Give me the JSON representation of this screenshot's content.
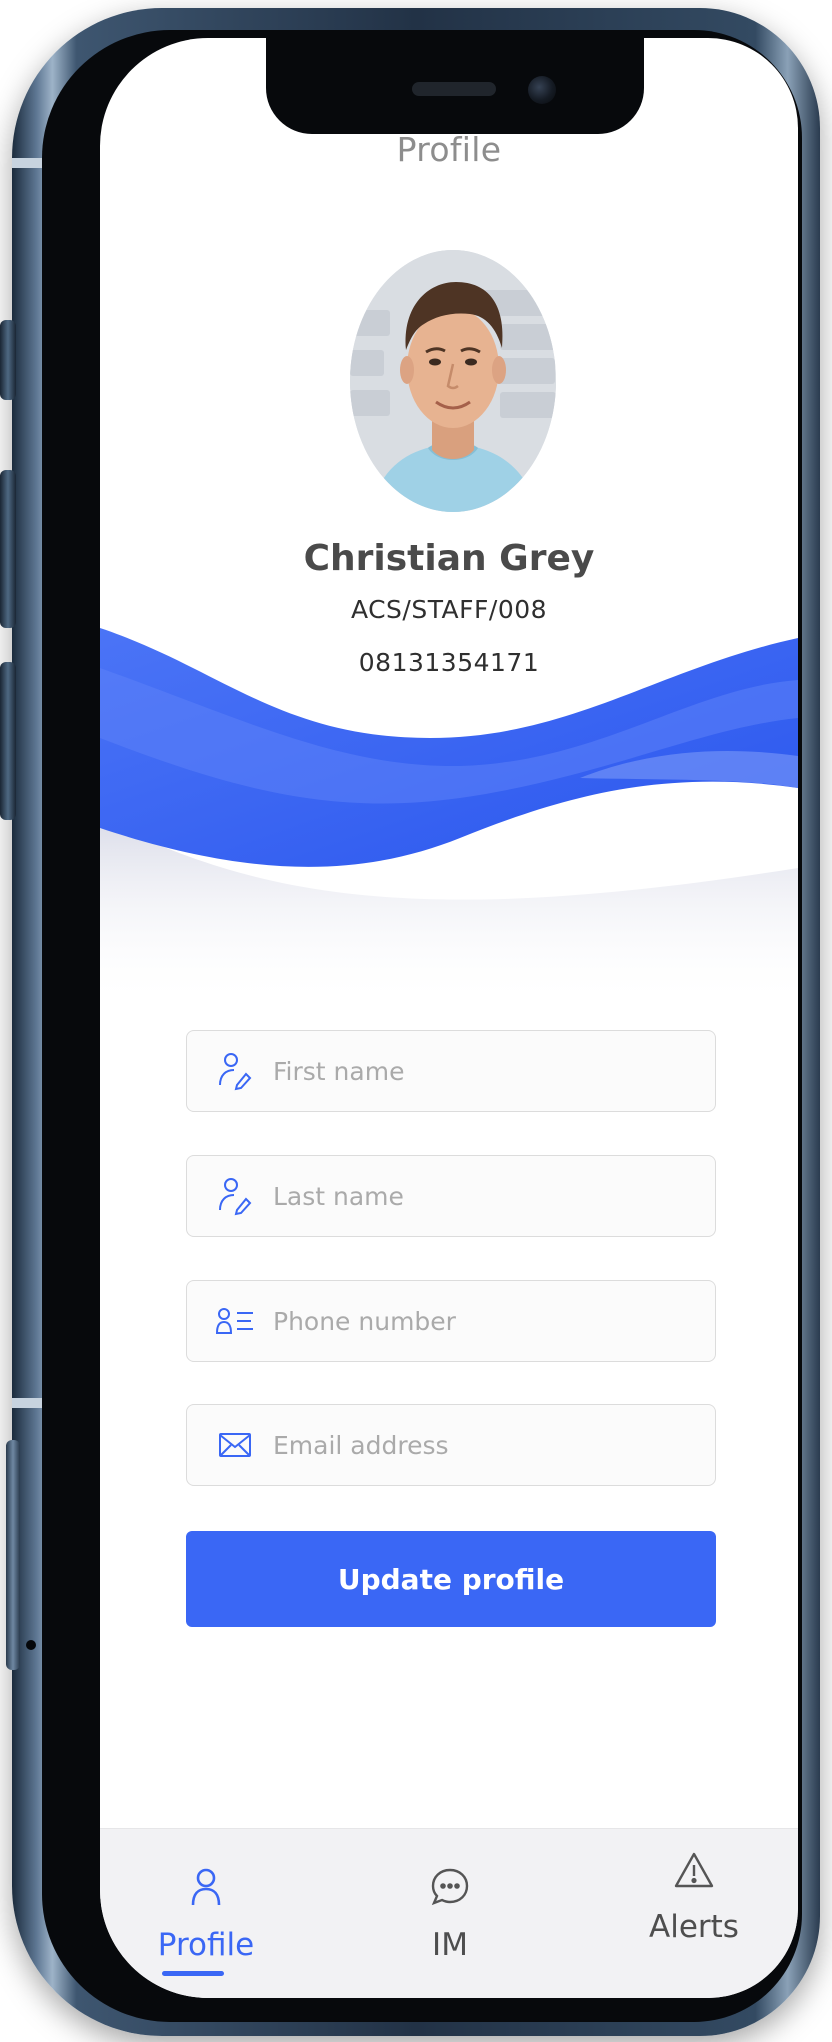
{
  "page": {
    "title": "Profile"
  },
  "user": {
    "name": "Christian Grey",
    "staff_id": "ACS/STAFF/008",
    "phone": "08131354171",
    "avatar_icon": "user-photo-avatar"
  },
  "form": {
    "first_name": {
      "placeholder": "First name",
      "icon": "user-edit-icon",
      "value": ""
    },
    "last_name": {
      "placeholder": "Last name",
      "icon": "user-edit-icon",
      "value": ""
    },
    "phone_number": {
      "placeholder": "Phone number",
      "icon": "contact-card-icon",
      "value": ""
    },
    "email_address": {
      "placeholder": "Email address",
      "icon": "envelope-icon",
      "value": ""
    },
    "submit_label": "Update profile"
  },
  "bottom_nav": {
    "items": [
      {
        "label": "Profile",
        "icon": "user-icon",
        "active": true
      },
      {
        "label": "IM",
        "icon": "chat-bubble-icon",
        "active": false
      },
      {
        "label": "Alerts",
        "icon": "warning-triangle-icon",
        "active": false
      }
    ]
  },
  "colors": {
    "accent": "#3a67f5",
    "wave_dark": "#2f5cf0",
    "wave_light": "#5a80f7",
    "text_primary": "#4a4a4a",
    "placeholder": "#aaaaaa",
    "nav_background": "#f2f2f4"
  }
}
